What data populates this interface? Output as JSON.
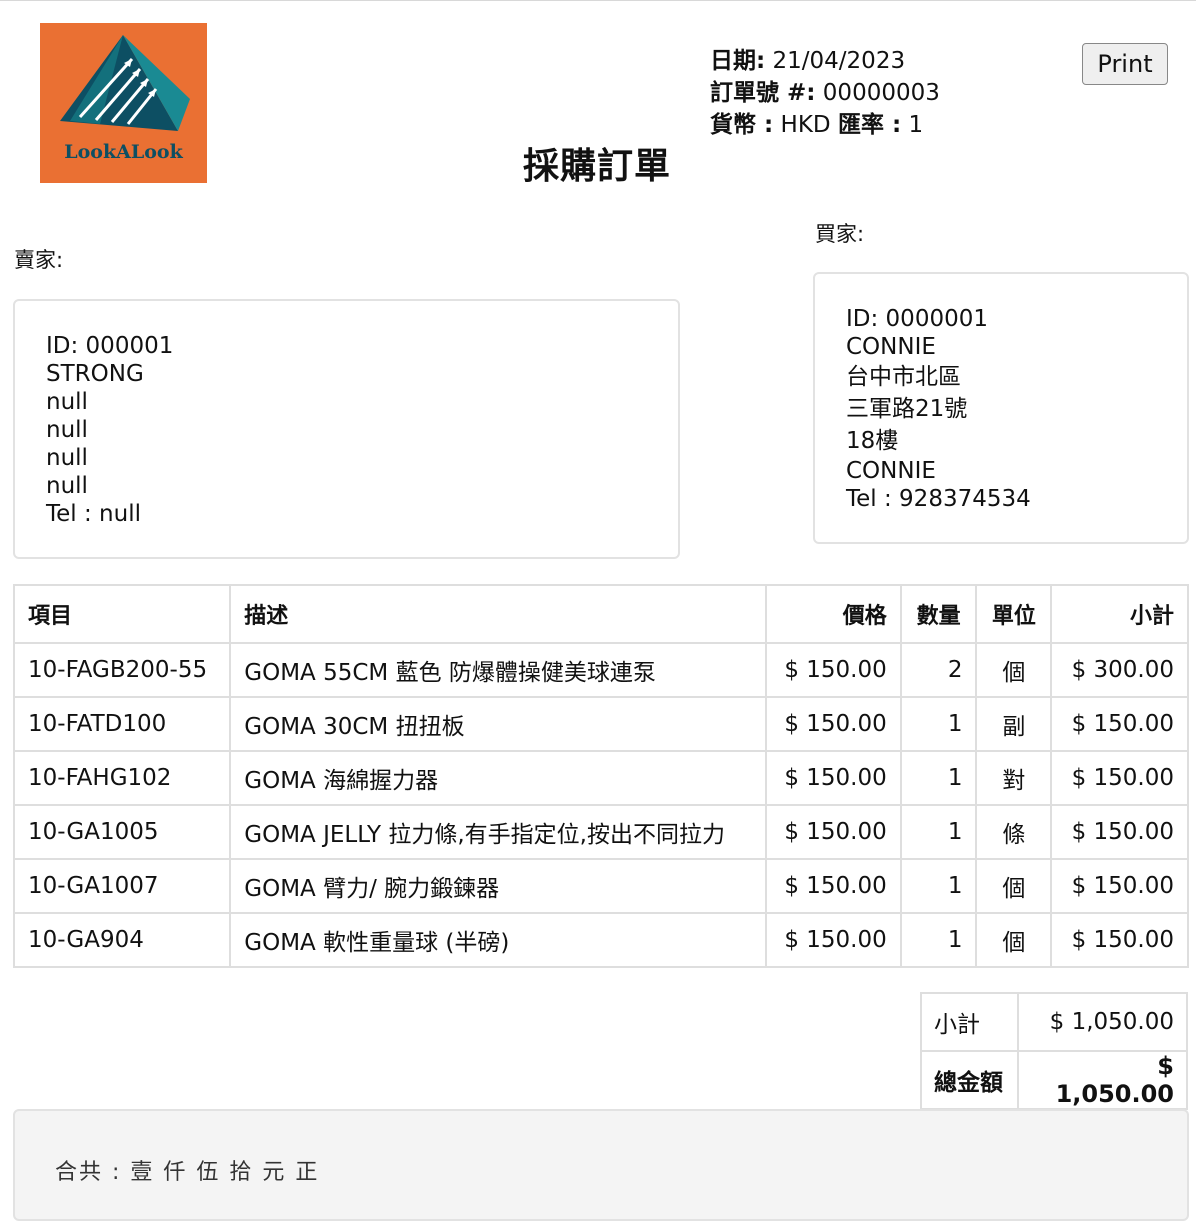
{
  "logo": {
    "text": "LookALook",
    "bg_color": "#ea7033",
    "accent_color": "#0d4f63"
  },
  "title": "採購訂單",
  "meta": {
    "date_label": "日期:",
    "date": "21/04/2023",
    "order_label": "訂單號 #:",
    "order_no": "00000003",
    "currency_label": "貨幣 :",
    "currency": "HKD",
    "rate_label": "匯率 :",
    "rate": "1"
  },
  "print_label": "Print",
  "seller": {
    "label": "賣家:",
    "lines": [
      "ID: 000001",
      "STRONG",
      "null",
      "null",
      "null",
      "null",
      "Tel : null"
    ]
  },
  "buyer": {
    "label": "買家:",
    "lines": [
      "ID: 0000001",
      "CONNIE",
      "台中市北區",
      "三軍路21號",
      "18樓",
      "CONNIE",
      "Tel : 928374534"
    ]
  },
  "table": {
    "headers": [
      "項目",
      "描述",
      "價格",
      "數量",
      "單位",
      "小計"
    ],
    "rows": [
      [
        "10-FAGB200-55",
        "GOMA 55CM 藍色 防爆體操健美球連泵",
        "$ 150.00",
        "2",
        "個",
        "$ 300.00"
      ],
      [
        "10-FATD100",
        "GOMA 30CM 扭扭板",
        "$ 150.00",
        "1",
        "副",
        "$ 150.00"
      ],
      [
        "10-FAHG102",
        "GOMA 海綿握力器",
        "$ 150.00",
        "1",
        "對",
        "$ 150.00"
      ],
      [
        "10-GA1005",
        "GOMA JELLY 拉力條,有手指定位,按出不同拉力",
        "$ 150.00",
        "1",
        "條",
        "$ 150.00"
      ],
      [
        "10-GA1007",
        "GOMA 臂力/ 腕力鍛鍊器",
        "$ 150.00",
        "1",
        "個",
        "$ 150.00"
      ],
      [
        "10-GA904",
        "GOMA 軟性重量球 (半磅)",
        "$ 150.00",
        "1",
        "個",
        "$ 150.00"
      ]
    ]
  },
  "totals": {
    "subtotal_label": "小計",
    "subtotal": "$ 1,050.00",
    "total_label": "總金額",
    "total": "$ 1,050.00"
  },
  "amount_in_words": "合共 : 壹 仟 伍 拾 元 正"
}
